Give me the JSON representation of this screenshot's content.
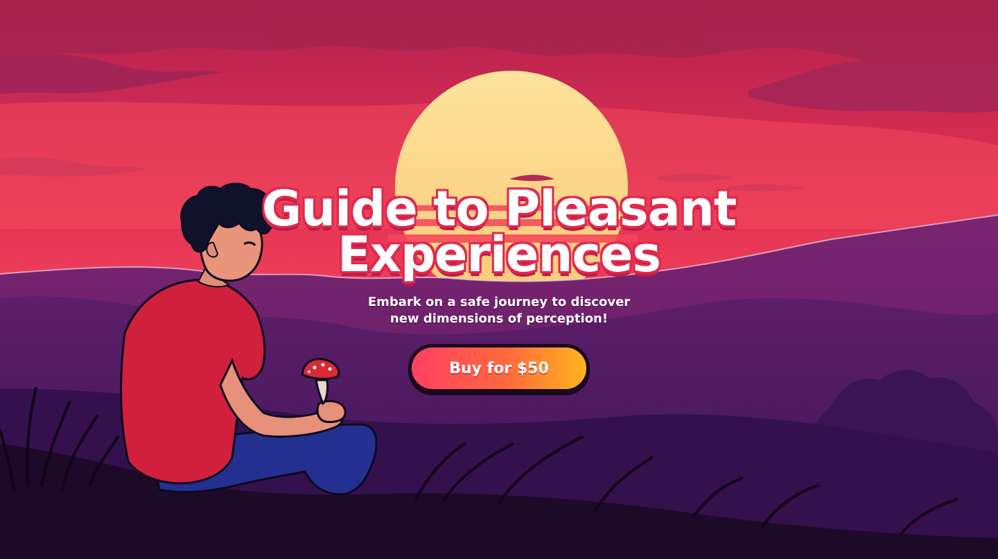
{
  "hero": {
    "title_line1": "Guide to Pleasant",
    "title_line2": "Experiences",
    "subtitle_line1": "Embark on a safe journey to discover",
    "subtitle_line2": "new dimensions of perception!",
    "buy_label": "Buy for $50"
  },
  "colors": {
    "sky_top": "#b3204e",
    "sky_bottom": "#f23e58",
    "sun": "#fcdc8c",
    "mountains": "#6a1f6e",
    "ground": "#1c0a26",
    "button_start": "#ff3f63",
    "button_end": "#ffb41e",
    "title_outline": "#e0294d"
  },
  "icons": {
    "mushroom": "mushroom-icon"
  }
}
